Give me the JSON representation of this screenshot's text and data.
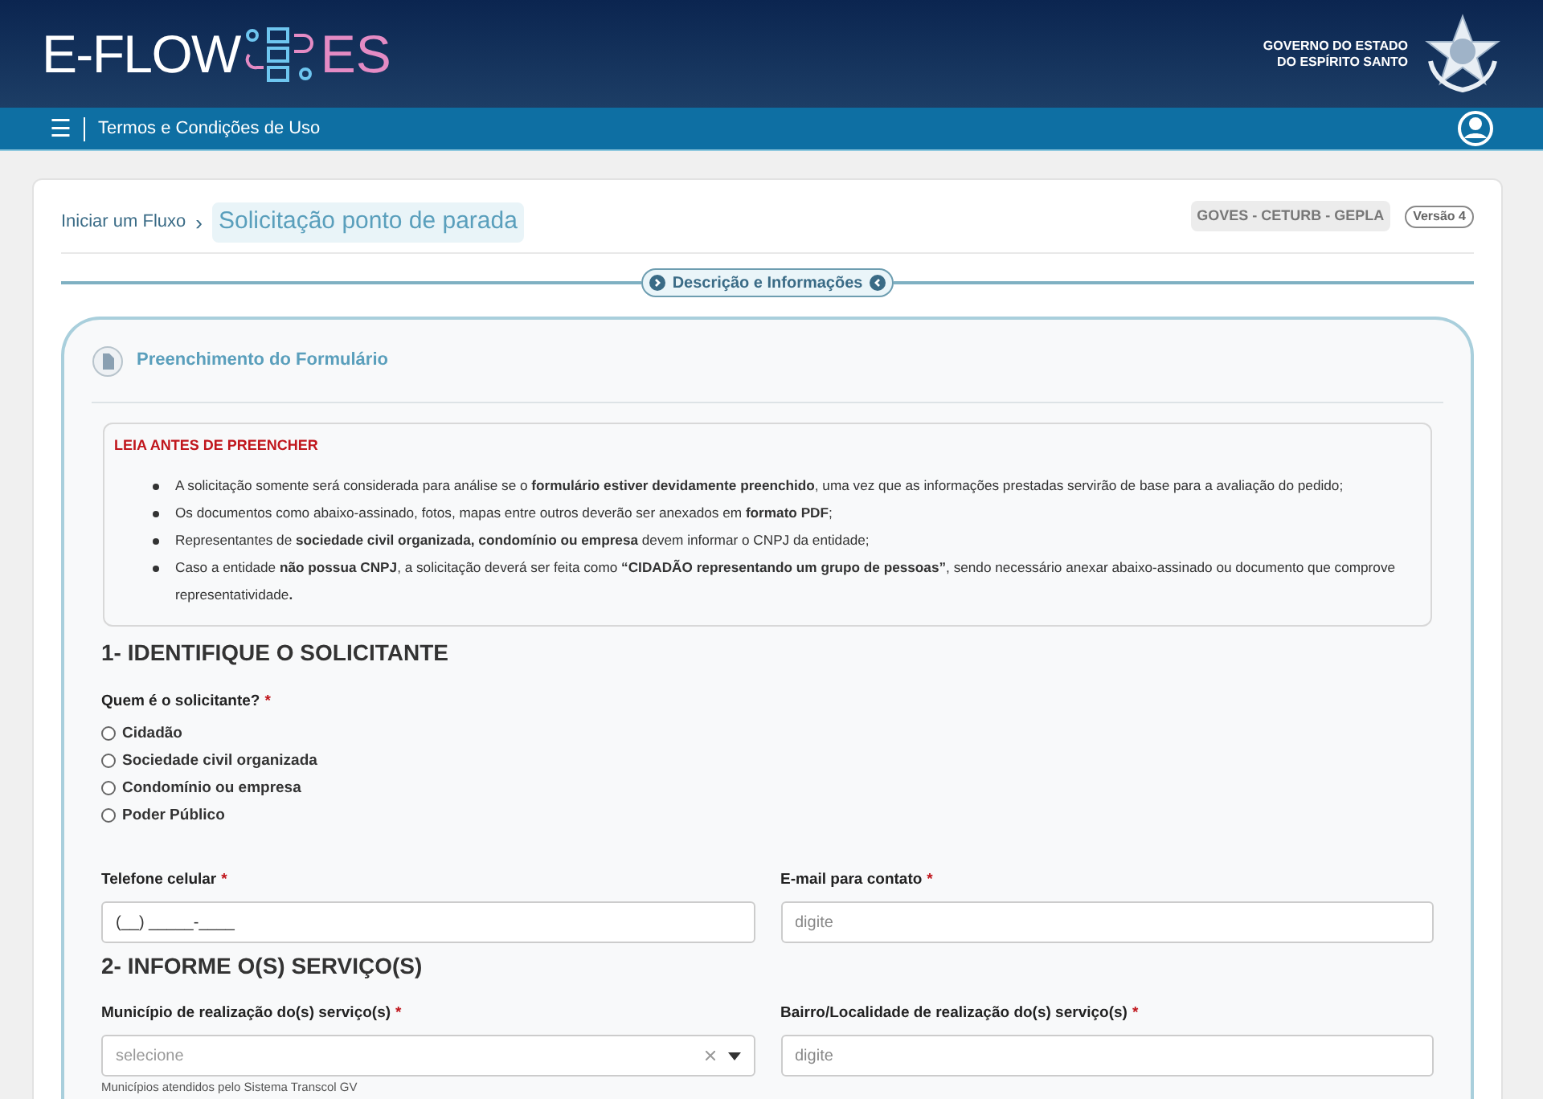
{
  "header": {
    "logo_text": "E-FLOW",
    "logo_suffix": "ES",
    "government": [
      "GOVERNO DO ESTADO",
      "DO ESPÍRITO SANTO"
    ]
  },
  "navbar": {
    "menu_icon": "☰",
    "link": "Termos e Condições de Uso"
  },
  "breadcrumb": {
    "parent": "Iniciar um Fluxo",
    "separator": "›",
    "current": "Solicitação ponto de parada"
  },
  "org_badge": "GOVES - CETURB - GEPLA",
  "version": "Versão 4",
  "section_toggle": {
    "label": "Descrição e Informações"
  },
  "panel": {
    "title": "Preenchimento do Formulário",
    "notice": {
      "title": "LEIA ANTES DE PREENCHER",
      "items": [
        "A solicitação somente será considerada para análise se o **formulário estiver devidamente preenchido**, uma vez que as informações prestadas servirão de base para a avaliação do pedido;",
        "Os documentos como abaixo-assinado, fotos, mapas entre outros deverão ser anexados em **formato PDF**;",
        "Representantes de **sociedade civil organizada, condomínio ou empresa** devem informar o CNPJ da entidade;",
        "Caso a entidade **não possua CNPJ**, a solicitação deverá ser feita como **“CIDADÃO representando um grupo de pessoas”**, sendo necessário anexar abaixo-assinado ou documento que comprove representatividade**.**"
      ]
    },
    "sections": [
      {
        "title": "1- IDENTIFIQUE O SOLICITANTE",
        "radio_group": {
          "label": "Quem é o solicitante?",
          "required_marker": "*",
          "options": [
            {
              "label": "Cidadão",
              "selected": false
            },
            {
              "label": "Sociedade civil organizada",
              "selected": false
            },
            {
              "label": "Condomínio ou empresa",
              "selected": false
            },
            {
              "label": "Poder Público",
              "selected": false
            }
          ]
        },
        "fields": [
          {
            "kind": "text",
            "label": "Telefone celular",
            "required_marker": "*",
            "value": "(__) _____-____"
          },
          {
            "kind": "text",
            "label": "E-mail para contato",
            "required_marker": "*",
            "placeholder": "digite"
          }
        ]
      },
      {
        "title": "2- INFORME O(S) SERVIÇO(S)",
        "fields": [
          {
            "kind": "select",
            "label": "Município de realização do(s) serviço(s)",
            "required_marker": "*",
            "placeholder": "selecione",
            "help": "Municípios atendidos pelo Sistema Transcol GV"
          },
          {
            "kind": "text",
            "label": "Bairro/Localidade de realização do(s) serviço(s)",
            "required_marker": "*",
            "placeholder": "digite"
          }
        ]
      }
    ]
  }
}
